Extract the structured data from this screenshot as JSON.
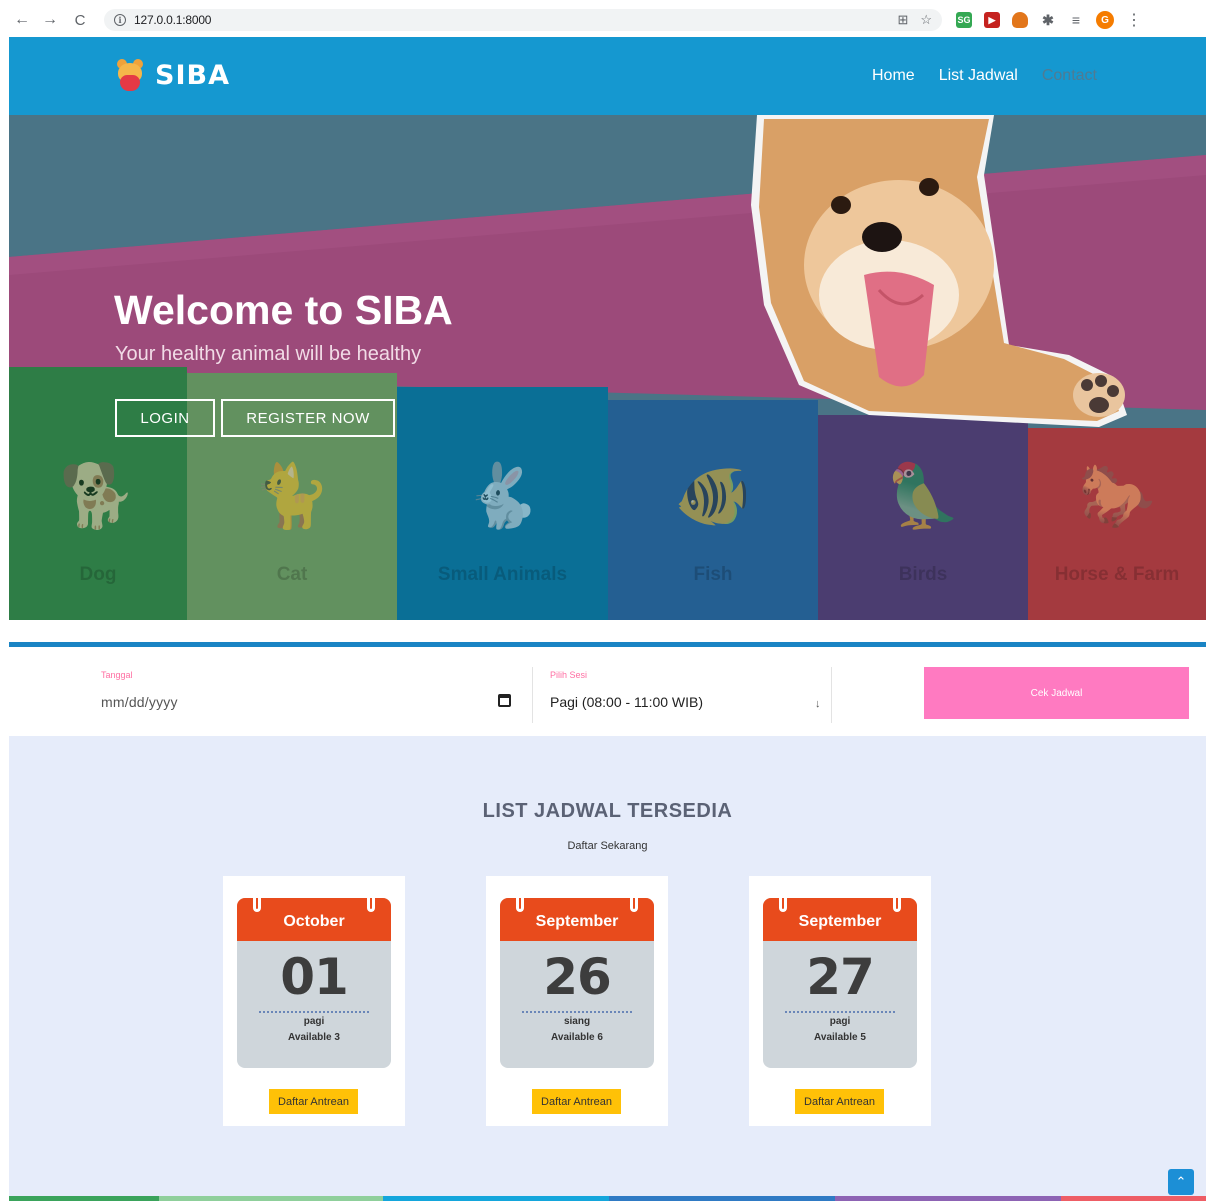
{
  "browser": {
    "url": "127.0.0.1:8000",
    "avatar_letter": "G",
    "ext_badge": "SG"
  },
  "site": {
    "brand": "SIBA",
    "nav": [
      {
        "label": "Home"
      },
      {
        "label": "List Jadwal"
      },
      {
        "label": "Contact"
      }
    ]
  },
  "hero": {
    "title": "Welcome to SIBA",
    "subtitle": "Your healthy animal will be healthy",
    "login_label": "LOGIN",
    "register_label": "REGISTER NOW",
    "categories": [
      {
        "label": "Dog",
        "color": "#2e7d46"
      },
      {
        "label": "Cat",
        "color": "#62915f"
      },
      {
        "label": "Small Animals",
        "color": "#0a6f96"
      },
      {
        "label": "Fish",
        "color": "#245f92"
      },
      {
        "label": "Birds",
        "color": "#4b3d70"
      },
      {
        "label": "Horse & Farm",
        "color": "#a43a3f"
      }
    ]
  },
  "booking": {
    "tanggal_label": "Tanggal",
    "date_placeholder": "mm/dd/yyyy",
    "sesi_label": "Pilih Sesi",
    "sesi_value": "Pagi (08:00 - 11:00 WIB)",
    "submit_label": "Cek Jadwal"
  },
  "schedule": {
    "title": "LIST JADWAL TERSEDIA",
    "subtitle": "Daftar Sekarang",
    "cards": [
      {
        "month": "October",
        "day": "01",
        "session": "pagi",
        "available": "Available 3",
        "button": "Daftar Antrean"
      },
      {
        "month": "September",
        "day": "26",
        "session": "siang",
        "available": "Available 6",
        "button": "Daftar Antrean"
      },
      {
        "month": "September",
        "day": "27",
        "session": "pagi",
        "available": "Available 5",
        "button": "Daftar Antrean"
      }
    ]
  },
  "colors": {
    "header": "#1598d0",
    "accent_pink": "#ff7ac1",
    "button_yellow": "#ffc107",
    "calendar_red": "#e84b1c"
  }
}
